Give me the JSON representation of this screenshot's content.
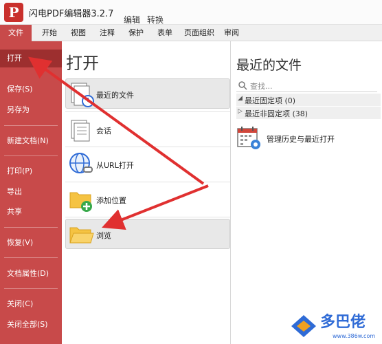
{
  "app": {
    "logo_letter": "P",
    "title": "闪电PDF编辑器3.2.7",
    "title_tabs": [
      "编辑",
      "转换"
    ]
  },
  "ribbon": {
    "tabs": [
      "文件",
      "开始",
      "视图",
      "注释",
      "保护",
      "表单",
      "页面组织",
      "审阅"
    ]
  },
  "sidebar": {
    "items": [
      "打开",
      "保存(S)",
      "另存为",
      "新建文档(N)",
      "打印(P)",
      "导出",
      "共享",
      "恢复(V)",
      "文档属性(D)",
      "关闭(C)",
      "关闭全部(S)"
    ],
    "active_index": 0
  },
  "middle": {
    "title": "打开",
    "options": [
      "最近的文件",
      "会话",
      "从URL打开",
      "添加位置",
      "浏览"
    ]
  },
  "right": {
    "title": "最近的文件",
    "search_placeholder": "查找...",
    "groups": [
      "最近固定项 (0)",
      "最近非固定项 (38)"
    ],
    "history_label": "管理历史与最近打开"
  },
  "watermark": {
    "text": "多巴佬",
    "url": "www.386w.com"
  },
  "colors": {
    "accent_red": "#c84a4a",
    "active_red": "#9d2f2f",
    "arrow_red": "#e03030"
  }
}
